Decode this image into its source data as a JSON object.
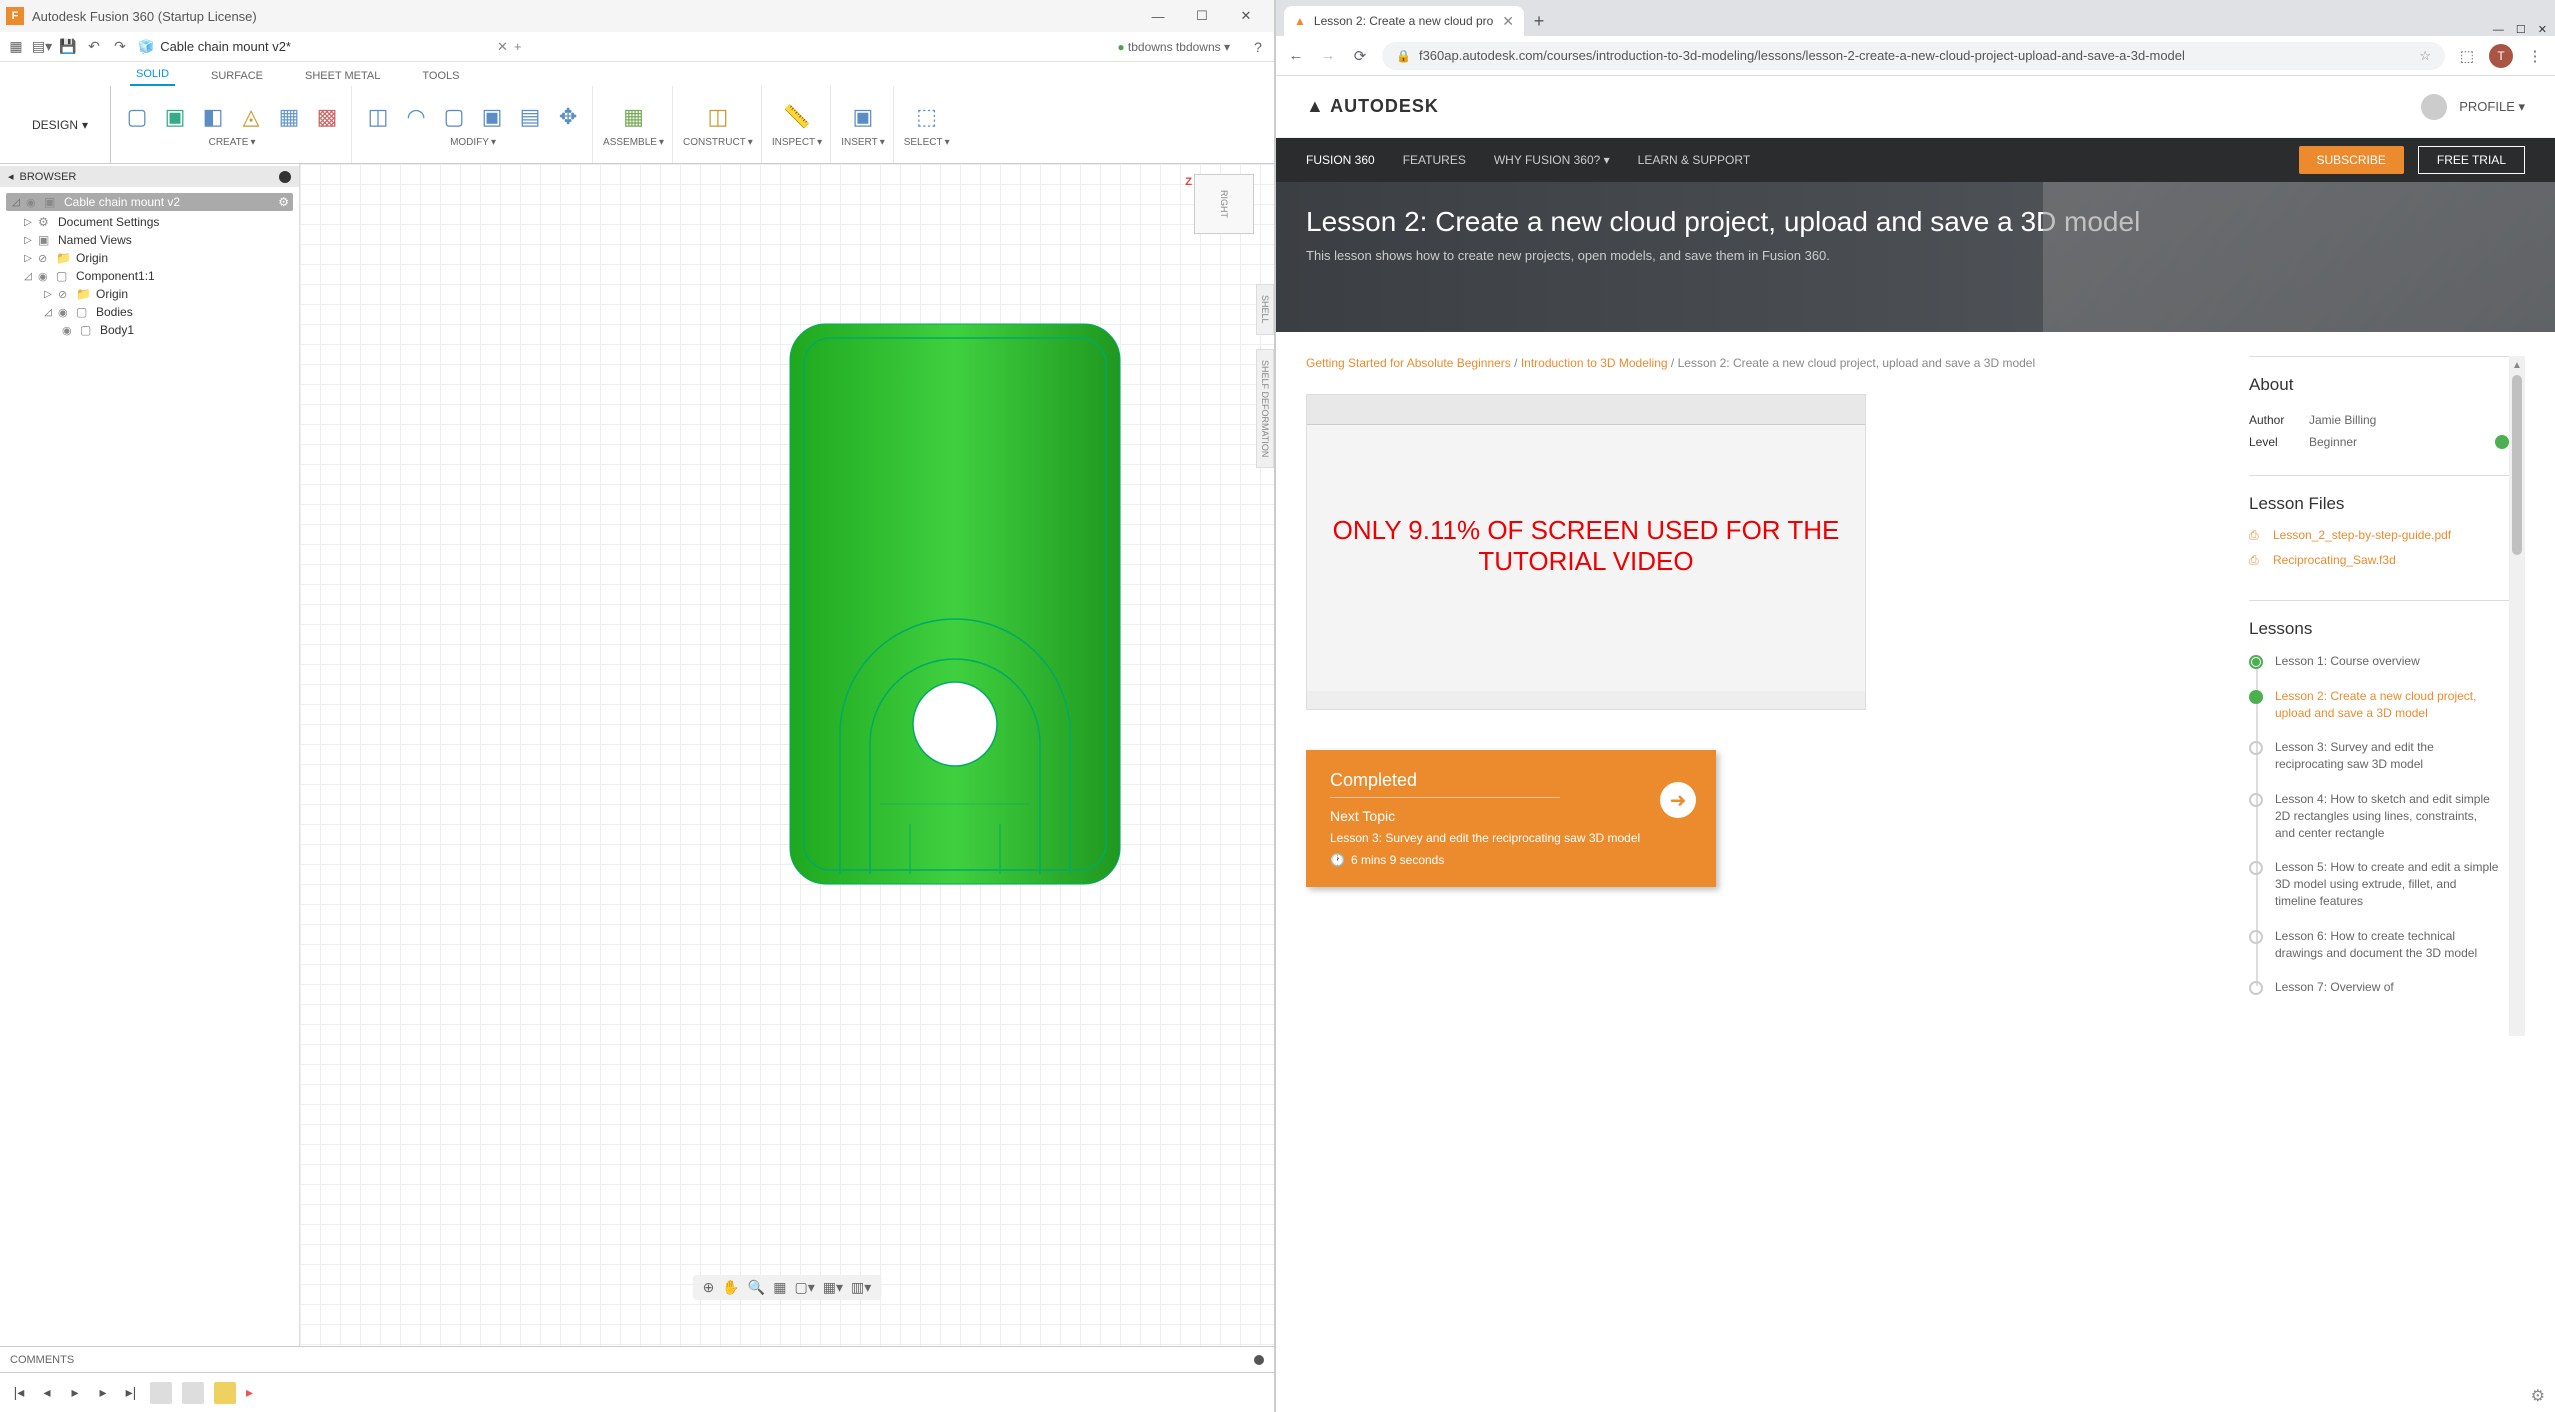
{
  "fusion": {
    "title": "Autodesk Fusion 360 (Startup License)",
    "doc_tab": "Cable chain mount v2*",
    "user": "tbdowns tbdowns",
    "workspace_btn": "DESIGN",
    "ribbon_tabs": [
      "SOLID",
      "SURFACE",
      "SHEET METAL",
      "TOOLS"
    ],
    "ribbon_groups": [
      "CREATE",
      "MODIFY",
      "ASSEMBLE",
      "CONSTRUCT",
      "INSPECT",
      "INSERT",
      "SELECT"
    ],
    "browser_title": "BROWSER",
    "tree": {
      "root": "Cable chain mount v2",
      "doc_settings": "Document Settings",
      "named_views": "Named Views",
      "origin": "Origin",
      "component": "Component1:1",
      "comp_origin": "Origin",
      "bodies": "Bodies",
      "body1": "Body1"
    },
    "viewcube": "RIGHT",
    "axis_z": "Z",
    "side_tabs": [
      "SHELL",
      "SHELF DEFORMATION"
    ],
    "comments": "COMMENTS"
  },
  "chrome": {
    "tab_title": "Lesson 2: Create a new cloud pro",
    "url": "f360ap.autodesk.com/courses/introduction-to-3d-modeling/lessons/lesson-2-create-a-new-cloud-project-upload-and-save-a-3d-model",
    "avatar_letter": "T",
    "header": {
      "logo": "▲ AUTODESK",
      "profile": "PROFILE"
    },
    "nav": {
      "brand": "FUSION 360",
      "items": [
        "FEATURES",
        "WHY FUSION 360? ▾",
        "LEARN & SUPPORT"
      ],
      "subscribe": "SUBSCRIBE",
      "trial": "FREE TRIAL"
    },
    "hero": {
      "title": "Lesson 2: Create a new cloud project, upload and save a 3D model",
      "sub": "This lesson shows how to create new projects, open models, and save them in Fusion 360."
    },
    "breadcrumb": {
      "a": "Getting Started for Absolute Beginners",
      "b": "Introduction to 3D Modeling",
      "c": "Lesson 2: Create a new cloud project, upload and save a 3D model"
    },
    "overlay": "ONLY 9.11% OF SCREEN USED FOR THE TUTORIAL VIDEO",
    "next": {
      "completed": "Completed",
      "next_topic": "Next Topic",
      "desc": "Lesson 3: Survey and edit the reciprocating saw 3D model",
      "time": "6 mins 9 seconds"
    },
    "about": {
      "title": "About",
      "author_lbl": "Author",
      "author": "Jamie Billing",
      "level_lbl": "Level",
      "level": "Beginner"
    },
    "files": {
      "title": "Lesson Files",
      "items": [
        "Lesson_2_step-by-step-guide.pdf",
        "Reciprocating_Saw.f3d"
      ]
    },
    "lessons": {
      "title": "Lessons",
      "items": [
        {
          "t": "Lesson 1: Course overview",
          "s": "done"
        },
        {
          "t": "Lesson 2: Create a new cloud project, upload and save a 3D model",
          "s": "cur"
        },
        {
          "t": "Lesson 3: Survey and edit the reciprocating saw 3D model",
          "s": ""
        },
        {
          "t": "Lesson 4: How to sketch and edit simple 2D rectangles using lines, constraints, and center rectangle",
          "s": ""
        },
        {
          "t": "Lesson 5: How to create and edit a simple 3D model using extrude, fillet, and timeline features",
          "s": ""
        },
        {
          "t": "Lesson 6: How to create technical drawings and document the 3D model",
          "s": ""
        },
        {
          "t": "Lesson 7: Overview of",
          "s": ""
        }
      ]
    }
  }
}
